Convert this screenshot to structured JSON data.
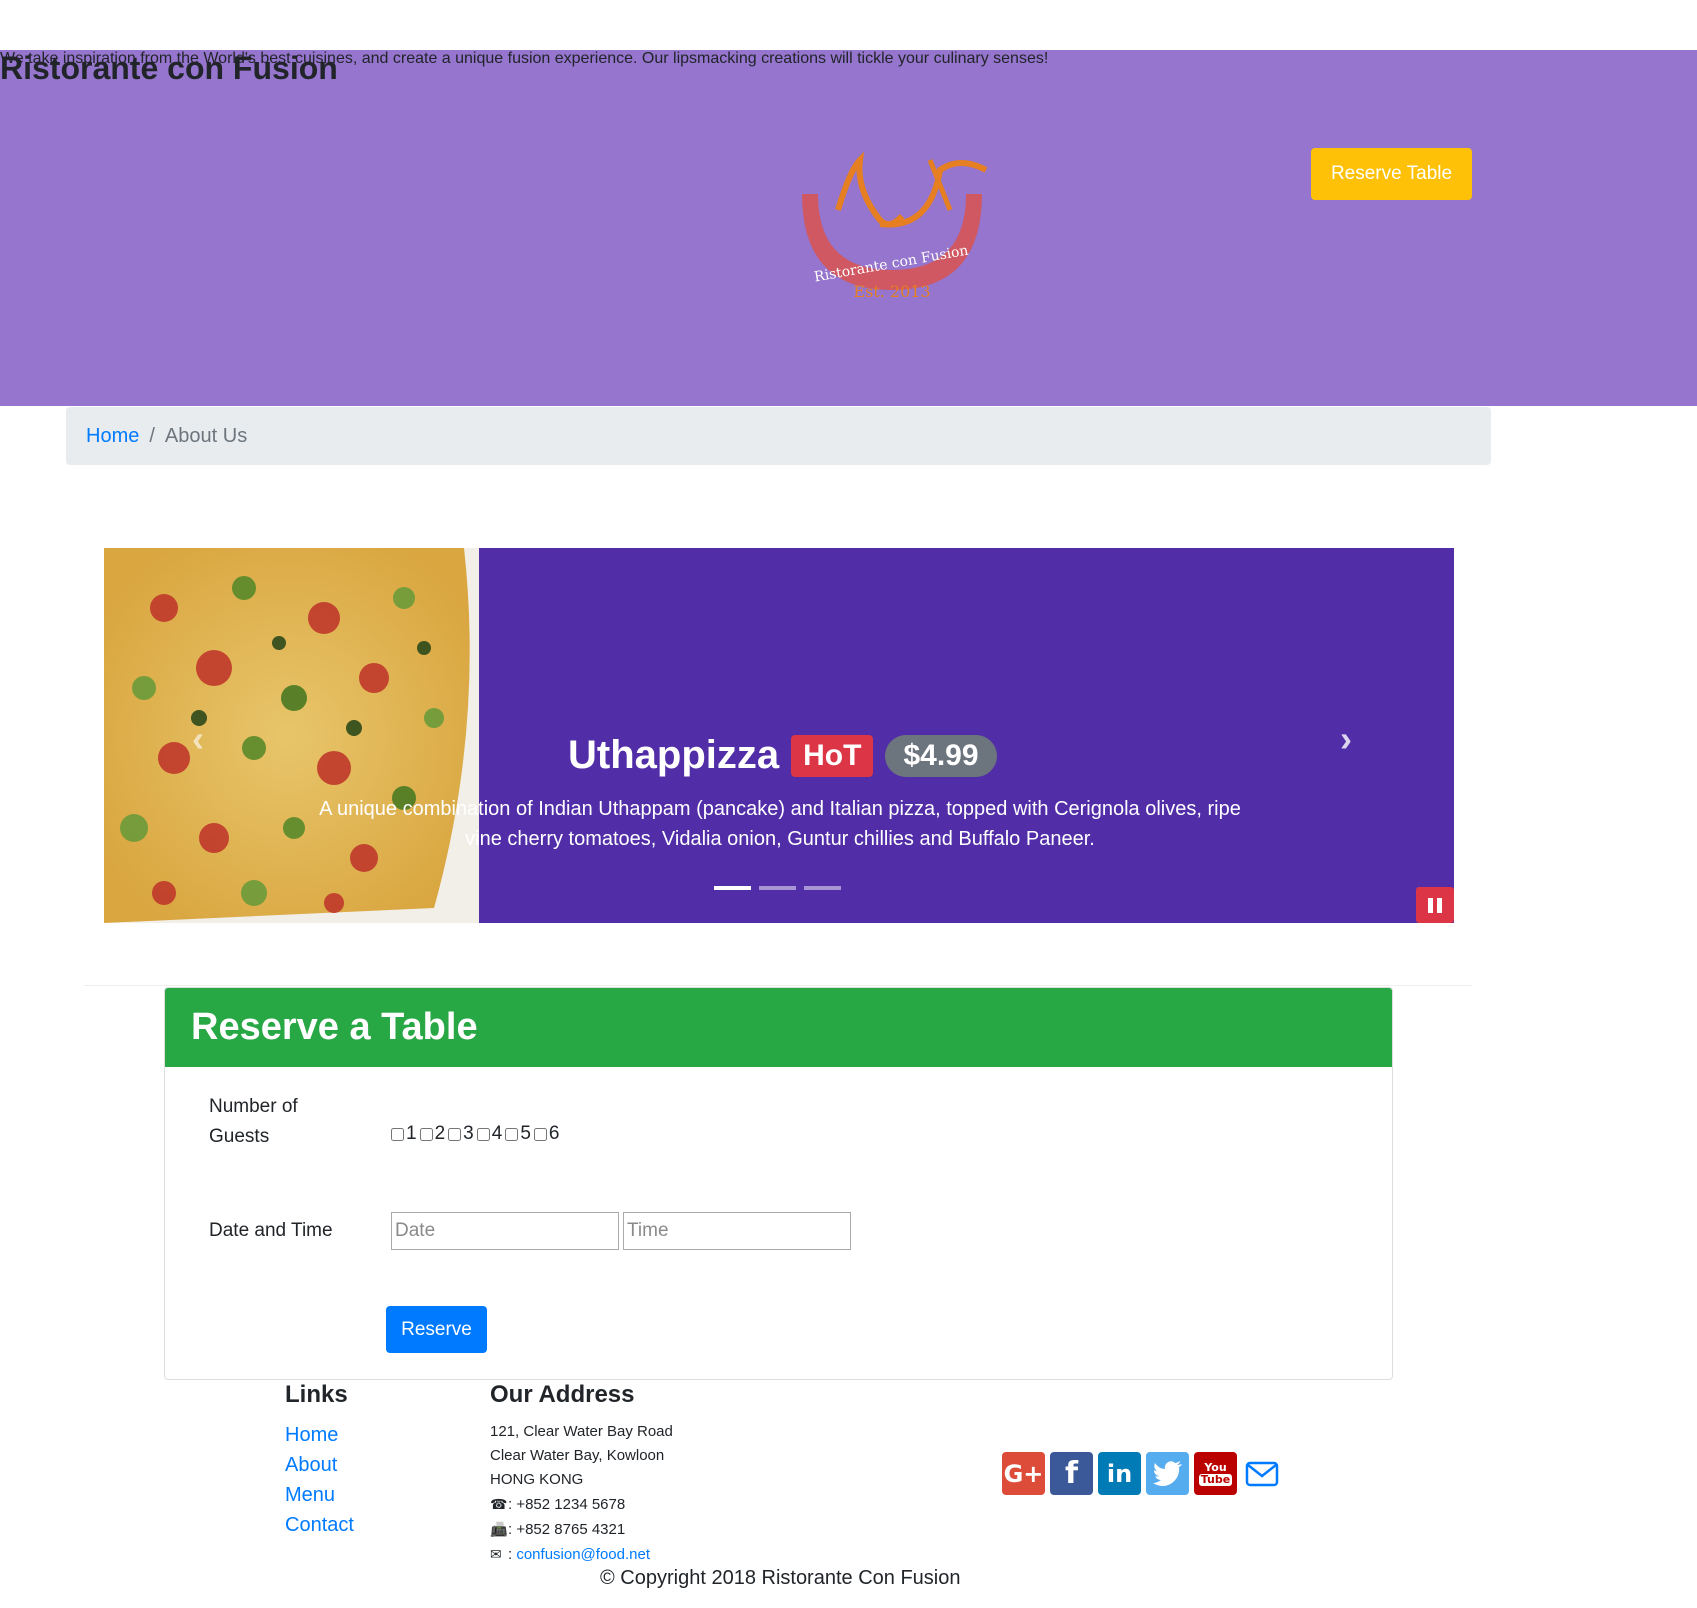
{
  "header": {
    "title": "Ristorante con Fusion",
    "lead": "We take inspiration from the World's best cuisines, and create a unique fusion experience. Our lipsmacking creations will tickle your culinary senses!",
    "reserve_button": "Reserve Table",
    "logo_text": "Ristorante con Fusion",
    "logo_est": "Est. 2013"
  },
  "breadcrumb": {
    "home": "Home",
    "separator": "/",
    "current": "About Us"
  },
  "carousel": {
    "item_name": "Uthappizza",
    "badge": "HoT",
    "price": "$4.99",
    "description": "A unique combination of Indian Uthappam (pancake) and Italian pizza, topped with Cerignola olives, ripe vine cherry tomatoes, Vidalia onion, Guntur chillies and Buffalo Paneer.",
    "prev_icon": "chevron-left-icon",
    "next_icon": "chevron-right-icon",
    "next_glyph": "›",
    "prev_glyph": "‹",
    "pause_icon": "pause-icon"
  },
  "reserve": {
    "title": "Reserve a Table",
    "guests_label": "Number of Guests",
    "guest_options": [
      "1",
      "2",
      "3",
      "4",
      "5",
      "6"
    ],
    "datetime_label": "Date and Time",
    "date_placeholder": "Date",
    "time_placeholder": "Time",
    "submit": "Reserve"
  },
  "footer": {
    "links_title": "Links",
    "links": [
      "Home",
      "About",
      "Menu",
      "Contact"
    ],
    "address_title": "Our Address",
    "address_lines": [
      "121, Clear Water Bay Road",
      "Clear Water Bay, Kowloon",
      "HONG KONG"
    ],
    "phone": ": +852 1234 5678",
    "fax": ": +852 8765 4321",
    "email_prefix": ": ",
    "email": "confusion@food.net",
    "social": {
      "google": "G+",
      "facebook": "f",
      "linkedin": "in",
      "youtube_top": "You",
      "youtube_bottom": "Tube"
    },
    "copyright": "© Copyright 2018 Ristorante Con Fusion"
  },
  "colors": {
    "jumbotron": "#9575cd",
    "carousel": "#512da8",
    "card_header": "#28a745",
    "warning": "#ffc107",
    "primary": "#007bff",
    "danger": "#dc3545"
  }
}
